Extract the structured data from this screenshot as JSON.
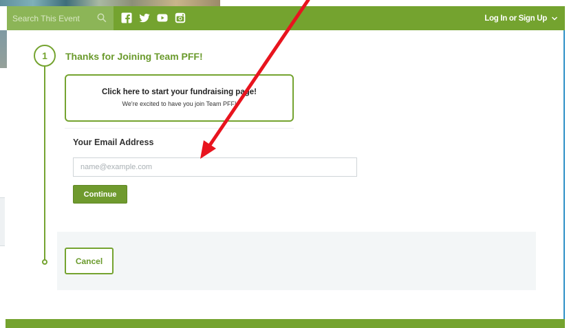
{
  "header": {
    "search_placeholder": "Search This Event",
    "social_icons": [
      "facebook-icon",
      "twitter-icon",
      "youtube-icon",
      "instagram-icon"
    ],
    "login_label": "Log In or Sign Up",
    "colors": {
      "bar": "#74a32f",
      "search_bg": "#8cb557"
    }
  },
  "step": {
    "number": "1",
    "title": "Thanks for Joining Team PFF!"
  },
  "fundraising_card": {
    "title": "Click here to start your fundraising page!",
    "subtitle": "We're excited to have you join Team PFF!"
  },
  "form": {
    "email_label": "Your Email Address",
    "email_value": "",
    "email_placeholder": "name@example.com",
    "continue_label": "Continue",
    "cancel_label": "Cancel"
  },
  "annotation": {
    "color": "#e8141e",
    "icon": "red-arrow"
  },
  "colors": {
    "accent": "#74a32f",
    "text_green": "#6a9a2c",
    "panel": "#f3f6f7",
    "right_rule": "#2b8fc6"
  }
}
